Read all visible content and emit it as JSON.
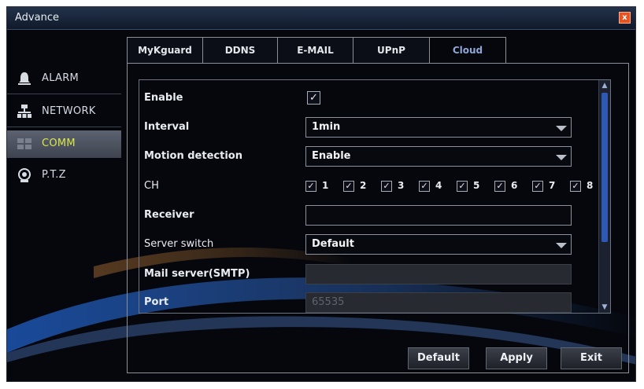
{
  "window": {
    "title": "Advance",
    "close_glyph": "x"
  },
  "sidebar": {
    "items": [
      {
        "label": "ALARM",
        "icon": "bell-icon"
      },
      {
        "label": "NETWORK",
        "icon": "network-icon"
      },
      {
        "label": "COMM",
        "icon": "comm-icon",
        "active": true
      },
      {
        "label": "P.T.Z",
        "icon": "camera-icon"
      }
    ]
  },
  "tabs": [
    {
      "label": "MyKguard"
    },
    {
      "label": "DDNS"
    },
    {
      "label": "E-MAIL"
    },
    {
      "label": "UPnP"
    },
    {
      "label": "Cloud",
      "active": true
    }
  ],
  "form": {
    "enable": {
      "label": "Enable",
      "checked": true
    },
    "interval": {
      "label": "Interval",
      "value": "1min"
    },
    "motion": {
      "label": "Motion detection",
      "value": "Enable"
    },
    "ch": {
      "label": "CH",
      "channels": [
        "1",
        "2",
        "3",
        "4",
        "5",
        "6",
        "7",
        "8"
      ]
    },
    "receiver": {
      "label": "Receiver",
      "value": ""
    },
    "server_switch": {
      "label": "Server switch",
      "value": "Default"
    },
    "mail_server": {
      "label": "Mail server(SMTP)",
      "value": ""
    },
    "port": {
      "label": "Port",
      "value": "65535"
    }
  },
  "buttons": {
    "default": "Default",
    "apply": "Apply",
    "exit": "Exit"
  },
  "colors": {
    "accent_active": "#d9e84a",
    "tab_active_text": "#8fa6d6",
    "close": "#e8531f",
    "scroll_thumb": "#2d59b3"
  }
}
